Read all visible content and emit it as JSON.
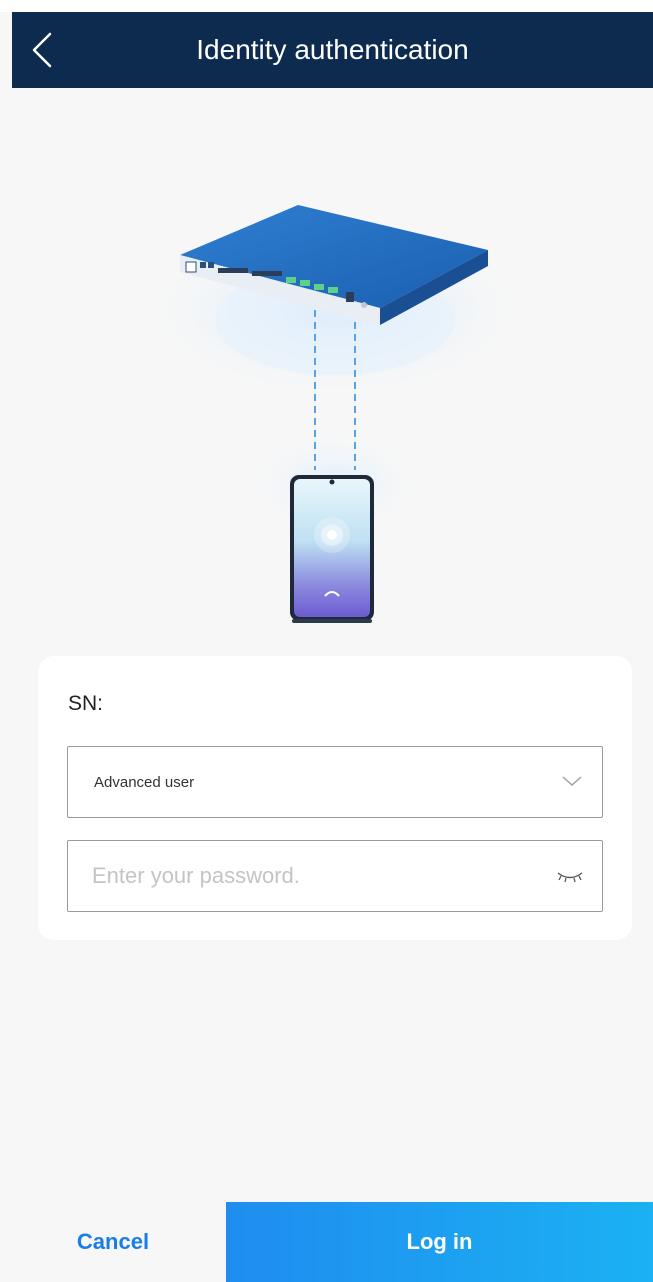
{
  "header": {
    "title": "Identity authentication",
    "back_icon": "chevron-left-icon"
  },
  "form": {
    "sn_label": "SN:",
    "user_select": {
      "value": "Advanced user",
      "icon": "chevron-down-icon"
    },
    "password": {
      "value": "",
      "placeholder": "Enter your password.",
      "icon": "eye-closed-icon"
    }
  },
  "footer": {
    "cancel_label": "Cancel",
    "login_label": "Log in"
  },
  "colors": {
    "header_bg": "#0d2a4f",
    "accent": "#1a7ee6",
    "login_gradient_start": "#1f8df0",
    "login_gradient_end": "#1bb1f2"
  }
}
